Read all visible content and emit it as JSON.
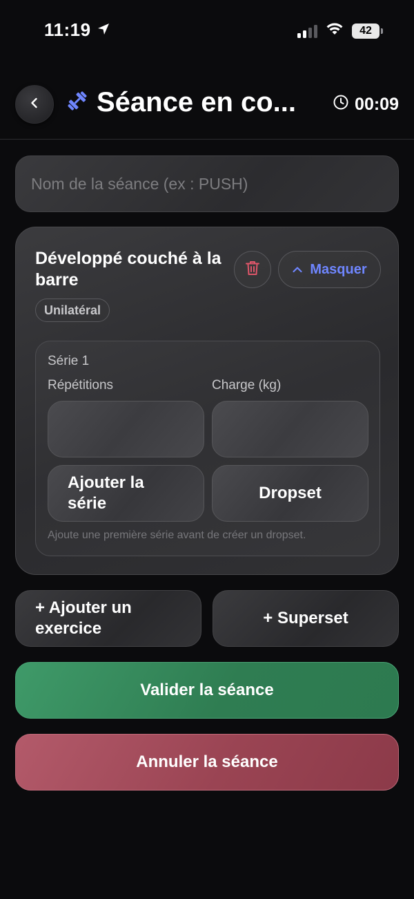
{
  "status_bar": {
    "time": "11:19",
    "battery": "42",
    "icons": [
      "location-arrow-icon",
      "signal-icon",
      "wifi-icon",
      "battery-icon"
    ]
  },
  "header": {
    "title": "Séance en co...",
    "title_icon": "dumbbell-icon",
    "back_icon": "chevron-left-icon",
    "timer_icon": "clock-icon",
    "timer": "00:09"
  },
  "session_name": {
    "placeholder": "Nom de la séance (ex : PUSH)",
    "value": ""
  },
  "exercise": {
    "name": "Développé couché à la barre",
    "delete_icon": "trash-icon",
    "collapse_label": "Masquer",
    "collapse_icon": "chevron-up-icon",
    "badge": "Unilatéral",
    "set": {
      "title": "Série 1",
      "reps_label": "Répétitions",
      "load_label": "Charge (kg)",
      "reps_value": "",
      "load_value": "",
      "add_set_label": "Ajouter la série",
      "dropset_label": "Dropset",
      "hint": "Ajoute une première série avant de créer un dropset."
    }
  },
  "actions": {
    "add_exercise": "+ Ajouter un exercice",
    "superset": "+ Superset",
    "validate": "Valider la séance",
    "cancel": "Annuler la séance"
  },
  "colors": {
    "accent_blue": "#6f86ff",
    "validate_green": "#2f7d52",
    "cancel_red": "#9a4453",
    "delete_red": "#e0566a",
    "background": "#0b0b0d"
  }
}
